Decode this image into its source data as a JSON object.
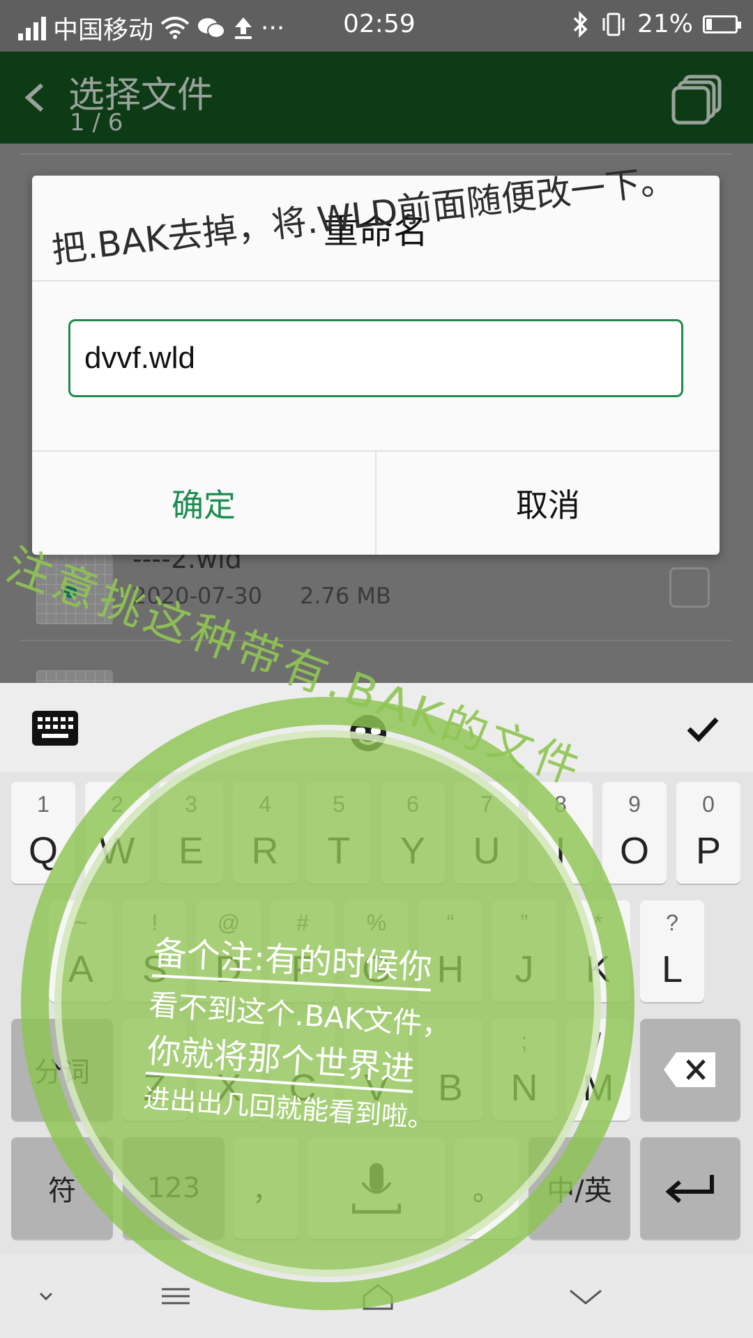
{
  "status_bar": {
    "carrier": "中国移动",
    "dots": "···",
    "time": "02:59",
    "battery": "21%",
    "battery_level": 0.21
  },
  "app_bar": {
    "title": "选择文件",
    "subtitle": "1 / 6"
  },
  "file_list": {
    "items": [
      {
        "name": "----2.wld",
        "date": "2020-07-30",
        "size": "2.76 MB"
      }
    ]
  },
  "dialog": {
    "title": "重命名",
    "input_value": "dvvf.wld",
    "confirm_label": "确定",
    "cancel_label": "取消"
  },
  "keyboard": {
    "row1": [
      {
        "num": "1",
        "label": "Q"
      },
      {
        "num": "2",
        "label": "W"
      },
      {
        "num": "3",
        "label": "E"
      },
      {
        "num": "4",
        "label": "R"
      },
      {
        "num": "5",
        "label": "T"
      },
      {
        "num": "6",
        "label": "Y"
      },
      {
        "num": "7",
        "label": "U"
      },
      {
        "num": "8",
        "label": "I"
      },
      {
        "num": "9",
        "label": "O"
      },
      {
        "num": "0",
        "label": "P"
      }
    ],
    "row2": [
      {
        "num": "~",
        "label": "A"
      },
      {
        "num": "!",
        "label": "S"
      },
      {
        "num": "@",
        "label": "D"
      },
      {
        "num": "#",
        "label": "F"
      },
      {
        "num": "%",
        "label": "G"
      },
      {
        "num": "“",
        "label": "H"
      },
      {
        "num": "”",
        "label": "J"
      },
      {
        "num": "*",
        "label": "K"
      },
      {
        "num": "?",
        "label": "L"
      }
    ],
    "row3": [
      {
        "num": "",
        "label": "Z"
      },
      {
        "num": "",
        "label": "X"
      },
      {
        "num": "",
        "label": "C"
      },
      {
        "num": "",
        "label": "V"
      },
      {
        "num": "",
        "label": "B"
      },
      {
        "num": ";",
        "label": "N"
      },
      {
        "num": "/",
        "label": "M"
      }
    ],
    "segment_label": "分词",
    "symbol_label": "符",
    "numbers_label": "123",
    "comma_label": "，",
    "period_label": "。",
    "lang_label": "中/英"
  },
  "annotations": {
    "top_note": "把.BAK去掉，将.WLD前面随便改一下。",
    "diagonal_note": "注意挑这种带有.BAK的文件",
    "circle_lines": [
      "备个注:有的时候你",
      "看不到这个.BAK文件，",
      "你就将那个世界进",
      "进出出几回就能看到啦。"
    ]
  },
  "colors": {
    "app_bar": "#0d3b16",
    "accent_green": "#1c8c52",
    "annotation_green": "#8fc454"
  }
}
